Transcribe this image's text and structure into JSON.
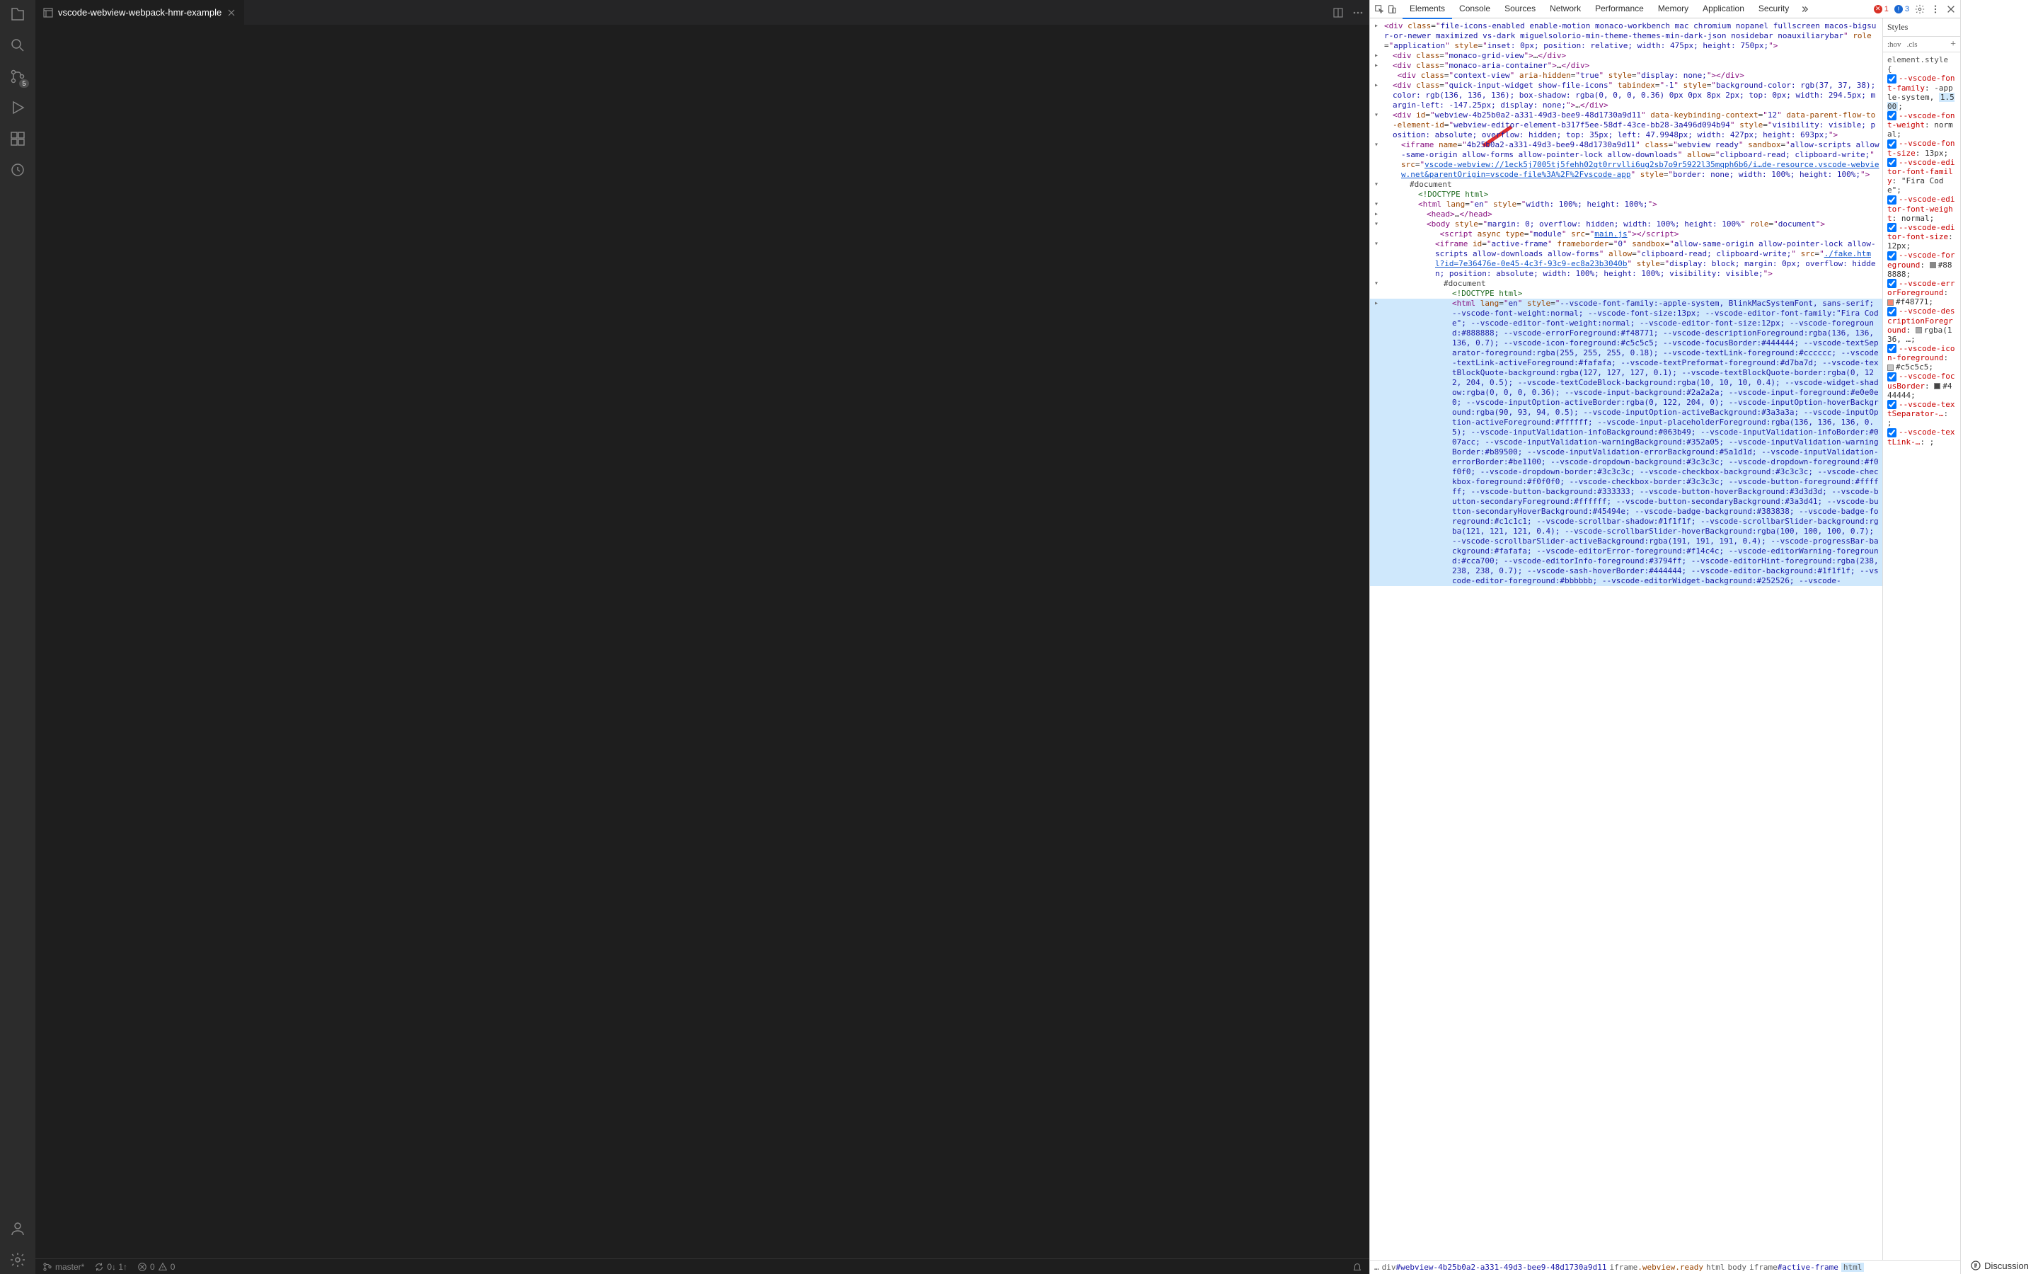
{
  "vscode": {
    "tab_title": "vscode-webview-webpack-hmr-example",
    "scm_badge": "5",
    "status": {
      "branch": "master*",
      "sync": "0↓ 1↑",
      "errors": "0",
      "warnings": "0"
    }
  },
  "devtools": {
    "tabs": [
      "Elements",
      "Console",
      "Sources",
      "Network",
      "Performance",
      "Memory",
      "Application",
      "Security"
    ],
    "active_tab": "Elements",
    "errors": "1",
    "warnings": "3",
    "styles_tab": "Styles",
    "filter_hov": ":hov",
    "filter_cls": ".cls",
    "dom": {
      "l0_pre": "▸<div class=\"",
      "l0_cls": "file-icons-enabled enable-motion monaco-workbench mac chromium nopanel fullscreen macos-bigsur-or-newer maximized vs-dark miguelsolorio-min-theme-themes-min-dark-json nosidebar noauxiliarybar",
      "l0_mid": "\" role=\"",
      "l0_role": "application",
      "l0_style": "inset: 0px; position: relative; width: 475px; height: 750px;",
      "l1": "▸<div class=\"monaco-grid-view\">…</div>",
      "l2": "▸<div class=\"monaco-aria-container\">…</div>",
      "l3": " <div class=\"context-view\" aria-hidden=\"true\" style=\"display: none;\"></div>",
      "l4a": "▸<div class=\"quick-input-widget show-file-icons\" tabindex=\"-1\" style=\"",
      "l4b": "background-color: rgb(37, 37, 38); color: rgb(136, 136, 136); box-shadow: rgba(0, 0, 0, 0.36) 0px 0px 8px 2px; top: 0px; width: 294.5px; margin-left: -147.25px; display: none;",
      "l4c": "\">…</div>",
      "l5a": "▾<div id=\"webview-4b25b0a2-a331-49d3-bee9-48d1730a9d11\" data-keybinding-context=\"12\" data-parent-flow-to-element-id=\"webview-editor-element-b317f5ee-58df-43ce-bb28-3a496d094b94\" style=\"",
      "l5b": "visibility: visible; position: absolute; overflow: hidden; top: 35px; left: 47.9948px; width: 427px; height: 693px;",
      "l5c": "\">",
      "l6a": "▾<iframe name=\"4b25b0a2-a331-49d3-bee9-48d1730a9d11\" class=\"webview ready\" sandbox=\"allow-scripts allow-same-origin allow-forms allow-pointer-lock allow-downloads\" allow=\"clipboard-read; clipboard-write;\" src=\"",
      "l6link": "vscode-webview://1eck5j7005tj5fehh02qt0rrvlli6ug2sb7o9r5922l35mqph6b6/i…de-resource.vscode-webview.net&parentOrigin=vscode-file%3A%2F%2Fvscode-app",
      "l6b": "\" style=\"border: none; width: 100%; height: 100%;\">",
      "l7": "▾#document",
      "l8": "<!DOCTYPE html>",
      "l9": "▾<html lang=\"en\" style=\"width: 100%; height: 100%;\">",
      "l10": "▸<head>…</head>",
      "l11": "▾<body style=\"margin: 0; overflow: hidden; width: 100%; height: 100%\" role=\"document\">",
      "l12a": " <script async type=\"module\" src=\"",
      "l12link": "main.js",
      "l12b": "\"></script>",
      "l13a": "▾<iframe id=\"active-frame\" frameborder=\"0\" sandbox=\"allow-same-origin allow-pointer-lock allow-scripts allow-downloads allow-forms\" allow=\"clipboard-read; clipboard-write;\" src=\"",
      "l13link": "./fake.html?id=7e36476e-0e45-4c3f-93c9-ec8a23b3040b",
      "l13b": "\" style=\"display: block; margin: 0px; overflow: hidden; position: absolute; width: 100%; height: 100%; visibility: visible;\">",
      "l14": "▾#document",
      "l15": "<!DOCTYPE html>",
      "l16a": "▸<html lang=\"en\" style=\"",
      "l16b": "--vscode-font-family:-apple-system, BlinkMacSystemFont, sans-serif; --vscode-font-weight:normal; --vscode-font-size:13px; --vscode-editor-font-family:\"Fira Code\"; --vscode-editor-font-weight:normal; --vscode-editor-font-size:12px; --vscode-foreground:#888888; --vscode-errorForeground:#f48771; --vscode-descriptionForeground:rgba(136, 136, 136, 0.7); --vscode-icon-foreground:#c5c5c5; --vscode-focusBorder:#444444; --vscode-textSeparator-foreground:rgba(255, 255, 255, 0.18); --vscode-textLink-foreground:#cccccc; --vscode-textLink-activeForeground:#fafafa; --vscode-textPreformat-foreground:#d7ba7d; --vscode-textBlockQuote-background:rgba(127, 127, 127, 0.1); --vscode-textBlockQuote-border:rgba(0, 122, 204, 0.5); --vscode-textCodeBlock-background:rgba(10, 10, 10, 0.4); --vscode-widget-shadow:rgba(0, 0, 0, 0.36); --vscode-input-background:#2a2a2a; --vscode-input-foreground:#e0e0e0; --vscode-inputOption-activeBorder:rgba(0, 122, 204, 0); --vscode-inputOption-hoverBackground:rgba(90, 93, 94, 0.5); --vscode-inputOption-activeBackground:#3a3a3a; --vscode-inputOption-activeForeground:#ffffff; --vscode-input-placeholderForeground:rgba(136, 136, 136, 0.5); --vscode-inputValidation-infoBackground:#063b49; --vscode-inputValidation-infoBorder:#007acc; --vscode-inputValidation-warningBackground:#352a05; --vscode-inputValidation-warningBorder:#b89500; --vscode-inputValidation-errorBackground:#5a1d1d; --vscode-inputValidation-errorBorder:#be1100; --vscode-dropdown-background:#3c3c3c; --vscode-dropdown-foreground:#f0f0f0; --vscode-dropdown-border:#3c3c3c; --vscode-checkbox-background:#3c3c3c; --vscode-checkbox-foreground:#f0f0f0; --vscode-checkbox-border:#3c3c3c; --vscode-button-foreground:#ffffff; --vscode-button-background:#333333; --vscode-button-hoverBackground:#3d3d3d; --vscode-button-secondaryForeground:#ffffff; --vscode-button-secondaryBackground:#3a3d41; --vscode-button-secondaryHoverBackground:#45494e; --vscode-badge-background:#383838; --vscode-badge-foreground:#c1c1c1; --vscode-scrollbar-shadow:#1f1f1f; --vscode-scrollbarSlider-background:rgba(121, 121, 121, 0.4); --vscode-scrollbarSlider-hoverBackground:rgba(100, 100, 100, 0.7); --vscode-scrollbarSlider-activeBackground:rgba(191, 191, 191, 0.4); --vscode-progressBar-background:#fafafa; --vscode-editorError-foreground:#f14c4c; --vscode-editorWarning-foreground:#cca700; --vscode-editorInfo-foreground:#3794ff; --vscode-editorHint-foreground:rgba(238, 238, 238, 0.7); --vscode-sash-hoverBorder:#444444; --vscode-editor-background:#1f1f1f; --vscode-editor-foreground:#bbbbbb; --vscode-editorWidget-background:#252526; --vscode-",
      "l16c": ""
    },
    "breadcrumbs": [
      {
        "txt": "…"
      },
      {
        "txt": "div",
        "id": "#webview-4b25b0a2-a331-49d3-bee9-48d1730a9d11"
      },
      {
        "txt": "iframe",
        "cls": ".webview.ready"
      },
      {
        "txt": "html"
      },
      {
        "txt": "body"
      },
      {
        "txt": "iframe",
        "id": "#active-frame"
      },
      {
        "txt": "html"
      }
    ],
    "styles": {
      "sel0": "element.style {",
      "props": [
        {
          "p": "--vscode-font-family",
          "v": "-apple-system, BlinkMacSystemFont, sans-serif",
          "chip": "1.500"
        },
        {
          "p": "--vscode-font-weight",
          "v": "normal"
        },
        {
          "p": "--vscode-font-size",
          "v": "13px"
        },
        {
          "p": "--vscode-editor-font-family",
          "v": "\"Fira Code\""
        },
        {
          "p": "--vscode-editor-font-weight",
          "v": "normal"
        },
        {
          "p": "--vscode-editor-font-size",
          "v": "12px"
        },
        {
          "p": "--vscode-foreground",
          "v": "#888888",
          "sw": "#888888"
        },
        {
          "p": "--vscode-errorForeground",
          "v": "#f48771",
          "sw": "#f48771"
        },
        {
          "p": "--vscode-descriptionForeground",
          "v": "rgba(136, …",
          "sw": "rgba(136,136,136,0.7)"
        },
        {
          "p": "--vscode-icon-foreground",
          "v": "#c5c5c5",
          "sw": "#c5c5c5"
        },
        {
          "p": "--vscode-focusBorder",
          "v": "#444444",
          "sw": "#444444"
        },
        {
          "p": "--vscode-textSeparator-…",
          "v": ""
        },
        {
          "p": "--vscode-textLink-…",
          "v": ""
        }
      ]
    }
  },
  "discussion_label": "Discussion"
}
